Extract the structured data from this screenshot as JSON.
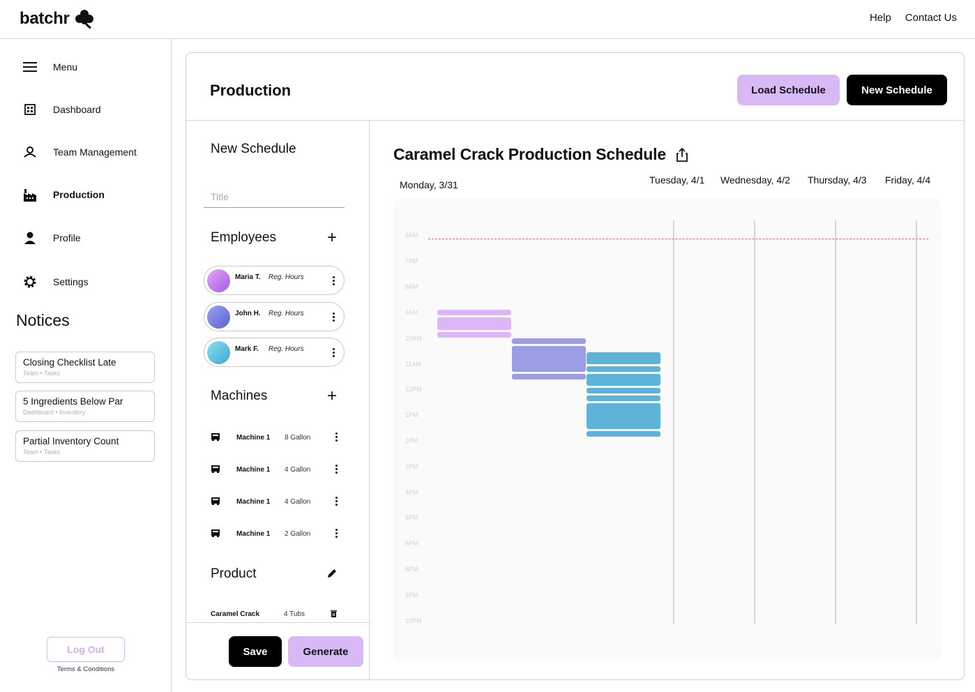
{
  "app": {
    "name": "batchr"
  },
  "topnav": {
    "help": "Help",
    "contact": "Contact Us"
  },
  "sidebar": {
    "items": [
      {
        "label": "Menu",
        "icon": "hamburger-icon"
      },
      {
        "label": "Dashboard",
        "icon": "dashboard-icon"
      },
      {
        "label": "Team Management",
        "icon": "team-icon"
      },
      {
        "label": "Production",
        "icon": "factory-icon",
        "active": true
      },
      {
        "label": "Profile",
        "icon": "person-icon"
      },
      {
        "label": "Settings",
        "icon": "gear-icon"
      }
    ],
    "notices_title": "Notices",
    "notices": [
      {
        "title": "Closing Checklist Late",
        "sub": "Team • Tasks"
      },
      {
        "title": "5 Ingredients Below Par",
        "sub": "Dashboard • Inventory"
      },
      {
        "title": "Partial Inventory Count",
        "sub": "Team • Tasks"
      }
    ],
    "logout": "Log Out",
    "terms": "Terms & Conditions"
  },
  "main": {
    "title": "Production",
    "load_button": "Load Schedule",
    "new_button": "New Schedule"
  },
  "form": {
    "title": "New Schedule",
    "title_placeholder": "Title",
    "employees_title": "Employees",
    "employees": [
      {
        "name": "Maria T.",
        "hours": "Reg. Hours",
        "color": "#c58af0"
      },
      {
        "name": "John H.",
        "hours": "Reg. Hours",
        "color": "#7b82e0"
      },
      {
        "name": "Mark F.",
        "hours": "Reg. Hours",
        "color": "#5cc2e6"
      }
    ],
    "machines_title": "Machines",
    "machines": [
      {
        "name": "Machine 1",
        "capacity": "8 Gallon"
      },
      {
        "name": "Machine 1",
        "capacity": "4 Gallon"
      },
      {
        "name": "Machine 1",
        "capacity": "4 Gallon"
      },
      {
        "name": "Machine 1",
        "capacity": "2 Gallon"
      }
    ],
    "product_title": "Product",
    "product": {
      "name": "Caramel Crack",
      "count": "4 Tubs"
    },
    "save": "Save",
    "generate": "Generate"
  },
  "schedule": {
    "title": "Caramel Crack Production Schedule",
    "days": [
      "Monday, 3/31",
      "Tuesday, 4/1",
      "Wednesday, 4/2",
      "Thursday, 4/3",
      "Friday, 4/4"
    ],
    "hours": [
      "6AM",
      "7AM",
      "8AM",
      "9AM",
      "10AM",
      "11AM",
      "12PM",
      "1PM",
      "2PM",
      "3PM",
      "4PM",
      "5PM",
      "6PM",
      "8PM",
      "9PM",
      "10PM"
    ],
    "colors": {
      "maria": "#dcb6f7",
      "john": "#9b9de6",
      "mark": "#5db3d8",
      "now": "#e2706c"
    }
  }
}
